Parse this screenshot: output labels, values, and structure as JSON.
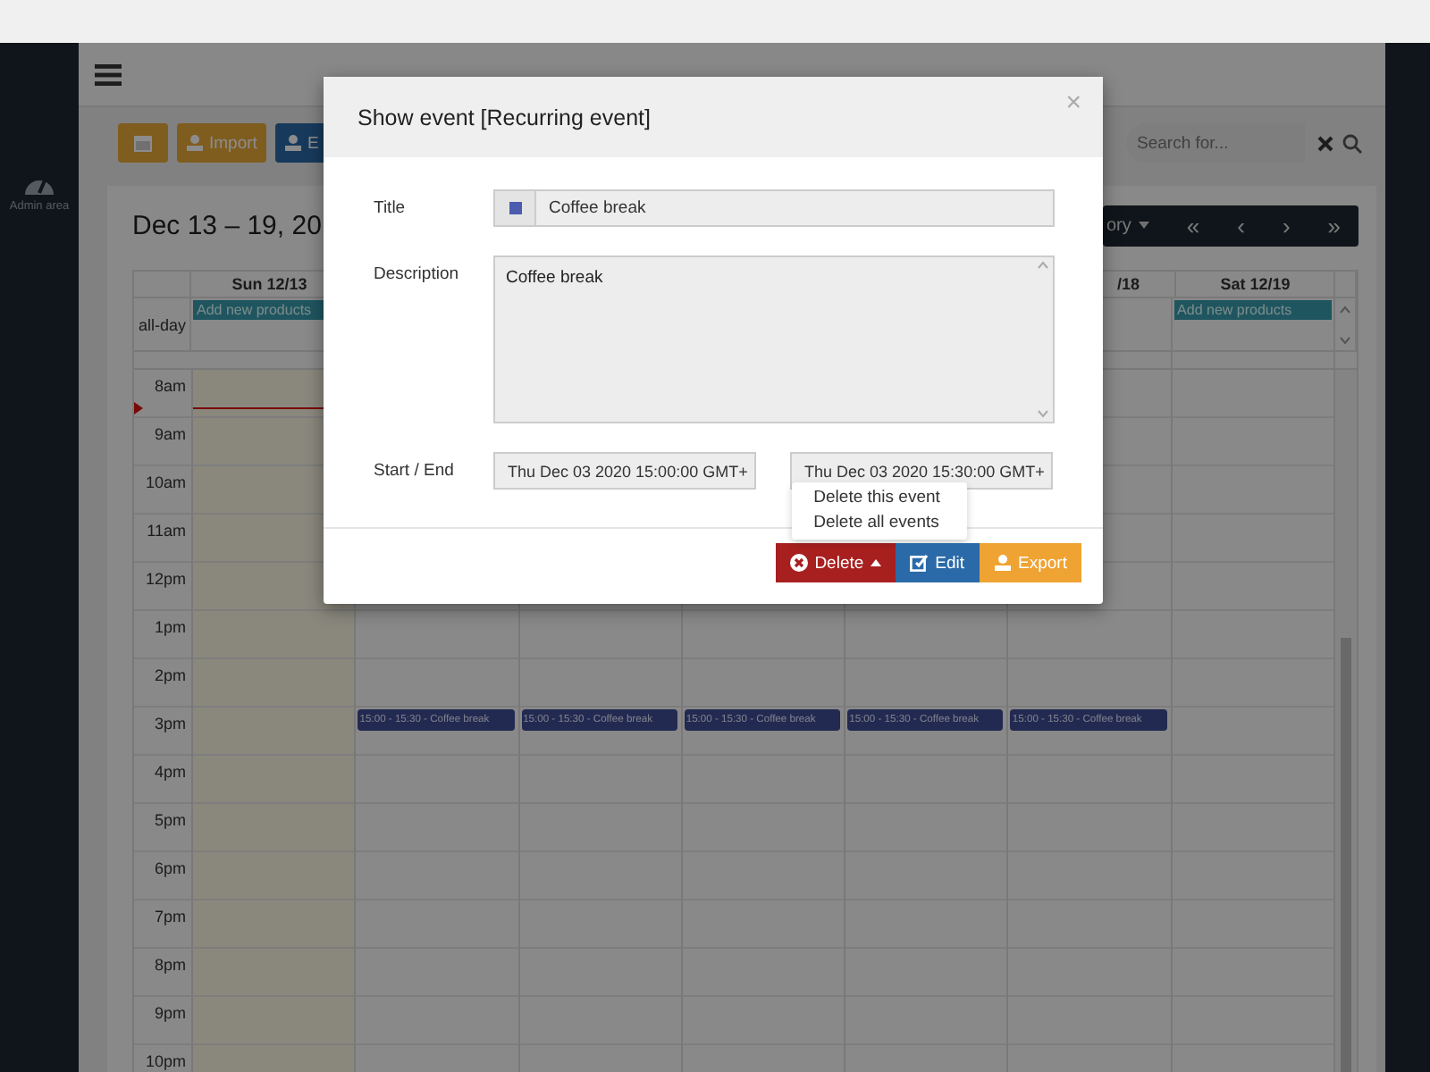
{
  "sidebar": {
    "items": [
      {
        "label": "Admin area",
        "selected": false
      }
    ]
  },
  "toolbar": {
    "buttons": [
      {
        "kind": "calendar"
      },
      {
        "kind": "import",
        "label": "Import"
      },
      {
        "kind": "export",
        "label": "E"
      }
    ]
  },
  "search": {
    "placeholder": "Search for..."
  },
  "calendar": {
    "title": "Dec 13 – 19, 20",
    "view_menu": "ory",
    "nav": [
      "«",
      "‹",
      "›",
      "»"
    ],
    "all_day_label": "all-day",
    "hours": [
      "8am",
      "9am",
      "10am",
      "11am",
      "12pm",
      "1pm",
      "2pm",
      "3pm",
      "4pm",
      "5pm",
      "6pm",
      "7pm",
      "8pm",
      "9pm",
      "10pm"
    ],
    "columns": [
      {
        "label": "Sun 12/13",
        "today": true,
        "all_day": "Add new products"
      },
      {
        "today": false,
        "events": [
          {
            "label": "15:00 - 15:30 - Coffee break"
          }
        ]
      },
      {
        "today": false,
        "events": [
          {
            "label": "15:00 - 15:30 - Coffee break"
          }
        ]
      },
      {
        "today": false,
        "events": [
          {
            "label": "15:00 - 15:30 - Coffee break"
          }
        ]
      },
      {
        "today": false,
        "events": [
          {
            "label": "15:00 - 15:30 - Coffee break"
          }
        ]
      },
      {
        "label": "/18",
        "today": false,
        "events": [
          {
            "label": "15:00 - 15:30 - Coffee break"
          }
        ]
      },
      {
        "label": "Sat 12/19",
        "today": false,
        "all_day": "Add new products"
      }
    ]
  },
  "modal": {
    "title": "Show event [Recurring event]",
    "close": "×",
    "fields": [
      {
        "kind": "color_text",
        "label": "Title",
        "color": "#4a5bb0",
        "value": "Coffee break"
      },
      {
        "kind": "textarea",
        "label": "Description",
        "value": "Coffee break"
      },
      {
        "kind": "range",
        "label": "Start / End",
        "start": "Thu Dec 03 2020 15:00:00 GMT+",
        "end": "Thu Dec 03 2020 15:30:00 GMT+"
      }
    ],
    "buttons": [
      {
        "kind": "delete",
        "label": "Delete",
        "expanded": true,
        "menu": [
          "Delete this event",
          "Delete all events"
        ]
      },
      {
        "kind": "edit",
        "label": "Edit"
      },
      {
        "kind": "export",
        "label": "Export"
      }
    ]
  }
}
